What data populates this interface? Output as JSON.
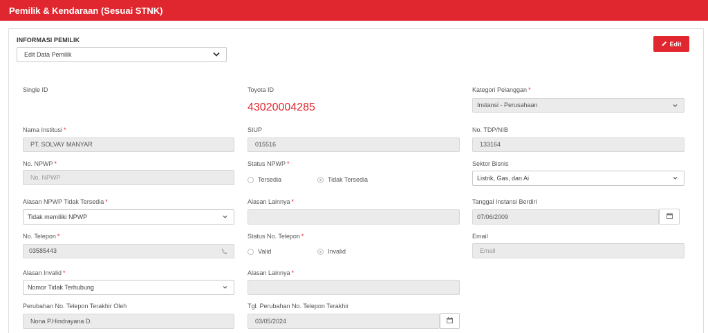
{
  "header": {
    "title": "Pemilik & Kendaraan (Sesuai STNK)"
  },
  "section": {
    "title": "INFORMASI PEMILIK",
    "owner_select": "Edit Data Pemilik",
    "edit_label": "Edit"
  },
  "fields": {
    "single_id": {
      "label": "Single ID"
    },
    "toyota_id": {
      "label": "Toyota ID",
      "value": "43020004285"
    },
    "kategori": {
      "label": "Kategori Pelanggan",
      "value": "Instansi - Perusahaan"
    },
    "nama_institusi": {
      "label": "Nama Institusi",
      "value": "PT. SOLVAY MANYAR"
    },
    "siup": {
      "label": "SIUP",
      "value": "015516"
    },
    "tdp_nib": {
      "label": "No. TDP/NIB",
      "value": "133164"
    },
    "npwp": {
      "label": "No. NPWP",
      "placeholder": "No. NPWP"
    },
    "status_npwp": {
      "label": "Status NPWP",
      "opt1": "Tersedia",
      "opt2": "Tidak Tersedia"
    },
    "sektor_bisnis": {
      "label": "Sektor Bisnis",
      "value": "Listrik, Gas, dan Ai"
    },
    "alasan_npwp": {
      "label": "Alasan NPWP Tidak Tersedia",
      "value": "Tidak memiliki NPWP"
    },
    "alasan_lainnya_1": {
      "label": "Alasan Lainnya"
    },
    "tanggal_berdiri": {
      "label": "Tanggal Instansi Berdiri",
      "value": "07/06/2009"
    },
    "no_telepon": {
      "label": "No. Telepon",
      "value": "03585443"
    },
    "status_telepon": {
      "label": "Status No. Telepon",
      "opt1": "Valid",
      "opt2": "Invalid"
    },
    "email": {
      "label": "Email",
      "placeholder": "Email"
    },
    "alasan_invalid": {
      "label": "Alasan Invalid",
      "value": "Nomor Tidak Terhubung"
    },
    "alasan_lainnya_2": {
      "label": "Alasan Lainnya"
    },
    "perubahan_oleh": {
      "label": "Perubahan No. Telepon Terakhir Oleh",
      "value": "Nona P.Hindrayana D."
    },
    "tgl_perubahan": {
      "label": "Tgl. Perubahan No. Telepon Terakhir",
      "value": "03/05/2024"
    }
  },
  "required_mark": "*",
  "colors": {
    "brand_red": "#e0262e",
    "field_gray": "#ebebeb"
  }
}
